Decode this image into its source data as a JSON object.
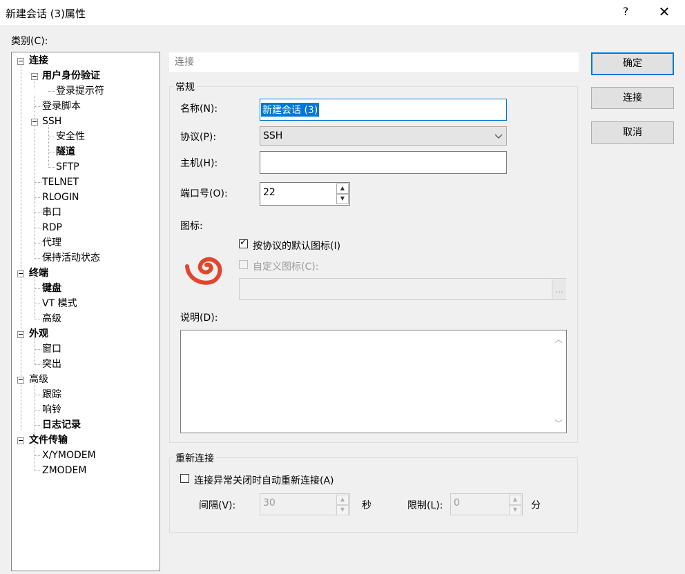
{
  "window": {
    "title": "新建会话 (3)属性",
    "help": "?",
    "close": "✕"
  },
  "category": {
    "label": "类别(C):",
    "items": [
      "连接",
      "用户身份验证",
      "登录提示符",
      "登录脚本",
      "SSH",
      "安全性",
      "隧道",
      "SFTP",
      "TELNET",
      "RLOGIN",
      "串口",
      "RDP",
      "代理",
      "保持活动状态",
      "终端",
      "键盘",
      "VT 模式",
      "高级",
      "外观",
      "窗口",
      "突出",
      "高级",
      "跟踪",
      "响铃",
      "日志记录",
      "文件传输",
      "X/YMODEM",
      "ZMODEM"
    ]
  },
  "section_title": "连接",
  "general": {
    "title": "常规",
    "name_label": "名称(N):",
    "name_value": "新建会话 (3)",
    "protocol_label": "协议(P):",
    "protocol_value": "SSH",
    "host_label": "主机(H):",
    "host_value": "",
    "port_label": "端口号(O):",
    "port_value": "22",
    "icon_label": "图标:",
    "default_icon_label": "按协议的默认图标(I)",
    "custom_icon_label": "自定义图标(C):",
    "browse_label": "...",
    "description_label": "说明(D):",
    "description_value": ""
  },
  "reconnect": {
    "title": "重新连接",
    "auto_label": "连接异常关闭时自动重新连接(A)",
    "interval_label": "间隔(V):",
    "interval_value": "30",
    "interval_unit": "秒",
    "limit_label": "限制(L):",
    "limit_value": "0",
    "limit_unit": "分"
  },
  "buttons": {
    "ok": "确定",
    "connect": "连接",
    "cancel": "取消"
  },
  "colors": {
    "accent": "#0078d7",
    "icon": "#e0462c"
  }
}
